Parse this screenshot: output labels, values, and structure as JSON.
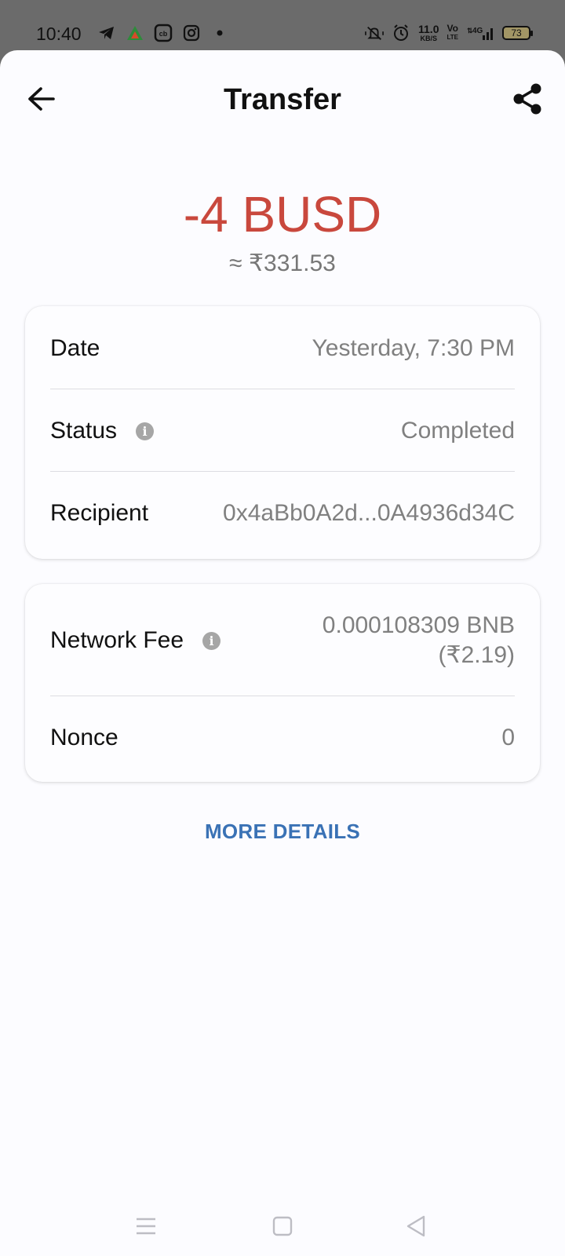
{
  "status_bar": {
    "time": "10:40",
    "left_icons": [
      "telegram-icon",
      "app-triangle-icon",
      "cb-app-icon",
      "instagram-icon",
      "dot-icon"
    ],
    "right_icons": [
      "vibrate-mute-icon",
      "alarm-icon",
      "volte-icon",
      "signal-4g-icon"
    ],
    "net_speed_value": "11.0",
    "net_speed_unit": "KB/S",
    "volte_top": "Vo",
    "volte_bottom": "LTE",
    "network": "4G",
    "battery": "73"
  },
  "header": {
    "title": "Transfer"
  },
  "transaction": {
    "amount": "-4 BUSD",
    "fiat": "≈ ₹331.53",
    "amount_color": "#c9483d"
  },
  "details": {
    "date_label": "Date",
    "date_value": "Yesterday, 7:30 PM",
    "status_label": "Status",
    "status_value": "Completed",
    "recipient_label": "Recipient",
    "recipient_value": "0x4aBb0A2d...0A4936d34C"
  },
  "fees": {
    "fee_label": "Network Fee",
    "fee_value_line1": "0.000108309 BNB",
    "fee_value_line2": "(₹2.19)",
    "nonce_label": "Nonce",
    "nonce_value": "0"
  },
  "actions": {
    "more_details": "MORE DETAILS",
    "link_color": "#3a72b5"
  },
  "navbar": {
    "icons": [
      "menu-icon",
      "home-square-icon",
      "back-triangle-icon"
    ]
  }
}
